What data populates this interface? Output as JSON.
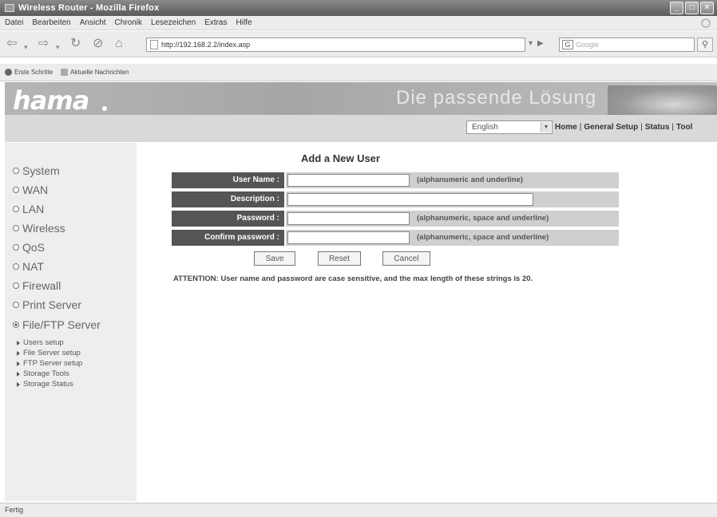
{
  "window": {
    "title": "Wireless Router - Mozilla Firefox"
  },
  "menubar": {
    "items": [
      "Datei",
      "Bearbeiten",
      "Ansicht",
      "Chronik",
      "Lesezeichen",
      "Extras",
      "Hilfe"
    ]
  },
  "navbar": {
    "url": "http://192.168.2.2/index.asp",
    "search_placeholder": "Google",
    "search_engine": "G"
  },
  "bookmarks": {
    "items": [
      "Erste Schritte",
      "Aktuelle Nachrichten"
    ]
  },
  "header": {
    "logo": "hama",
    "slogan": "Die passende Lösung",
    "language": "English",
    "links": [
      "Home",
      "General Setup",
      "Status",
      "Tool"
    ]
  },
  "sidebar": {
    "items": [
      "System",
      "WAN",
      "LAN",
      "Wireless",
      "QoS",
      "NAT",
      "Firewall",
      "Print Server",
      "File/FTP Server"
    ],
    "active_index": 8,
    "subitems": [
      "Users setup",
      "File Server setup",
      "FTP Server setup",
      "Storage Tools",
      "Storage Status"
    ]
  },
  "form": {
    "title": "Add a New User",
    "fields": [
      {
        "label": "User Name :",
        "value": "",
        "hint": "(alphanumeric and underline)"
      },
      {
        "label": "Description :",
        "value": "",
        "hint": ""
      },
      {
        "label": "Password :",
        "value": "",
        "hint": "(alphanumeric, space and underline)"
      },
      {
        "label": "Confirm password :",
        "value": "",
        "hint": "(alphanumeric, space and underline)"
      }
    ],
    "buttons": {
      "save": "Save",
      "reset": "Reset",
      "cancel": "Cancel"
    },
    "attention": "ATTENTION: User name and password are case sensitive, and the max length of these strings is 20."
  },
  "status": {
    "text": "Fertig"
  }
}
